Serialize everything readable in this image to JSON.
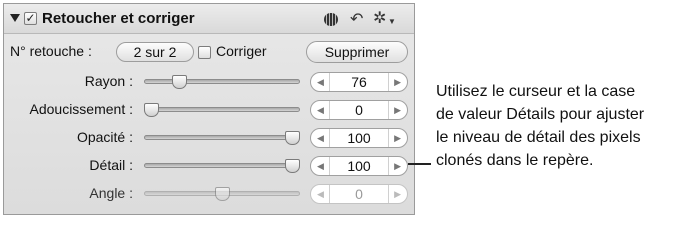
{
  "panel": {
    "title": "Retoucher et corriger",
    "header_checked": "✓",
    "icons": [
      "brush-icon",
      "undo-icon",
      "gear-icon"
    ]
  },
  "retouch": {
    "label": "N° retouche :",
    "value": "2 sur 2",
    "correct_label": "Corriger",
    "delete_button": "Supprimer"
  },
  "sliders": [
    {
      "label": "Rayon :",
      "value": "76",
      "fraction": 0.2,
      "enabled": true
    },
    {
      "label": "Adoucissement :",
      "value": "0",
      "fraction": 0.0,
      "enabled": true
    },
    {
      "label": "Opacité :",
      "value": "100",
      "fraction": 1.0,
      "enabled": true
    },
    {
      "label": "Détail :",
      "value": "100",
      "fraction": 1.0,
      "enabled": true
    },
    {
      "label": "Angle :",
      "value": "0",
      "fraction": 0.5,
      "enabled": false
    }
  ],
  "callout": {
    "lines": [
      "Utilisez le curseur et la case",
      "de valeur Détails pour ajuster",
      "le niveau de détail des pixels",
      "clonés dans le repère."
    ]
  }
}
